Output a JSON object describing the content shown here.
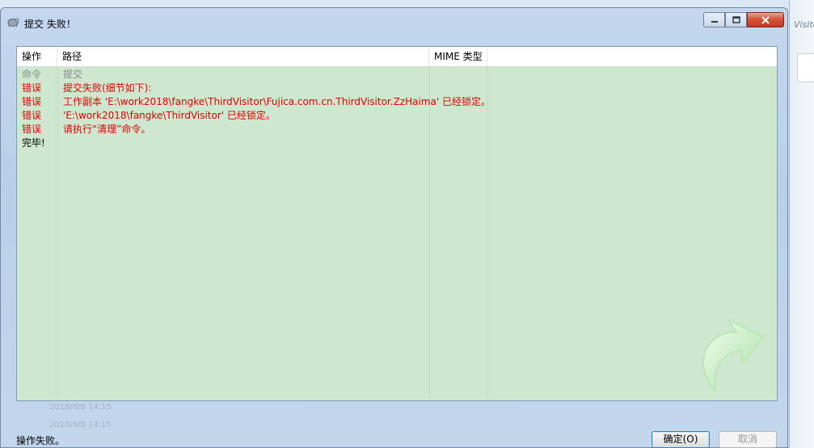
{
  "window": {
    "title": "提交 失败！",
    "minimize_label": "minimize",
    "maximize_label": "maximize",
    "close_label": "close"
  },
  "background": {
    "right_text": "Visito"
  },
  "list": {
    "columns": [
      "操作",
      "路径",
      "MIME 类型",
      ""
    ],
    "rows": [
      {
        "kind": "cmd",
        "action": "命令",
        "path": "提交"
      },
      {
        "kind": "err",
        "action": "错误",
        "path": "提交失败(细节如下):"
      },
      {
        "kind": "err",
        "action": "错误",
        "path": "工作副本 'E:\\work2018\\fangke\\ThirdVisitor\\Fujica.com.cn.ThirdVisitor.ZzHaima' 已经锁定。"
      },
      {
        "kind": "err",
        "action": "错误",
        "path": "'E:\\work2018\\fangke\\ThirdVisitor' 已经锁定。"
      },
      {
        "kind": "err",
        "action": "错误",
        "path": "请执行“清理”命令。"
      },
      {
        "kind": "done",
        "action": "完毕!",
        "path": ""
      }
    ]
  },
  "footer": {
    "status": "操作失败。",
    "ok_label": "确定(O)",
    "cancel_label": "取消"
  },
  "colors": {
    "list_bg": "#cde8cf",
    "error": "#e00000",
    "command": "#8a8a8a"
  }
}
